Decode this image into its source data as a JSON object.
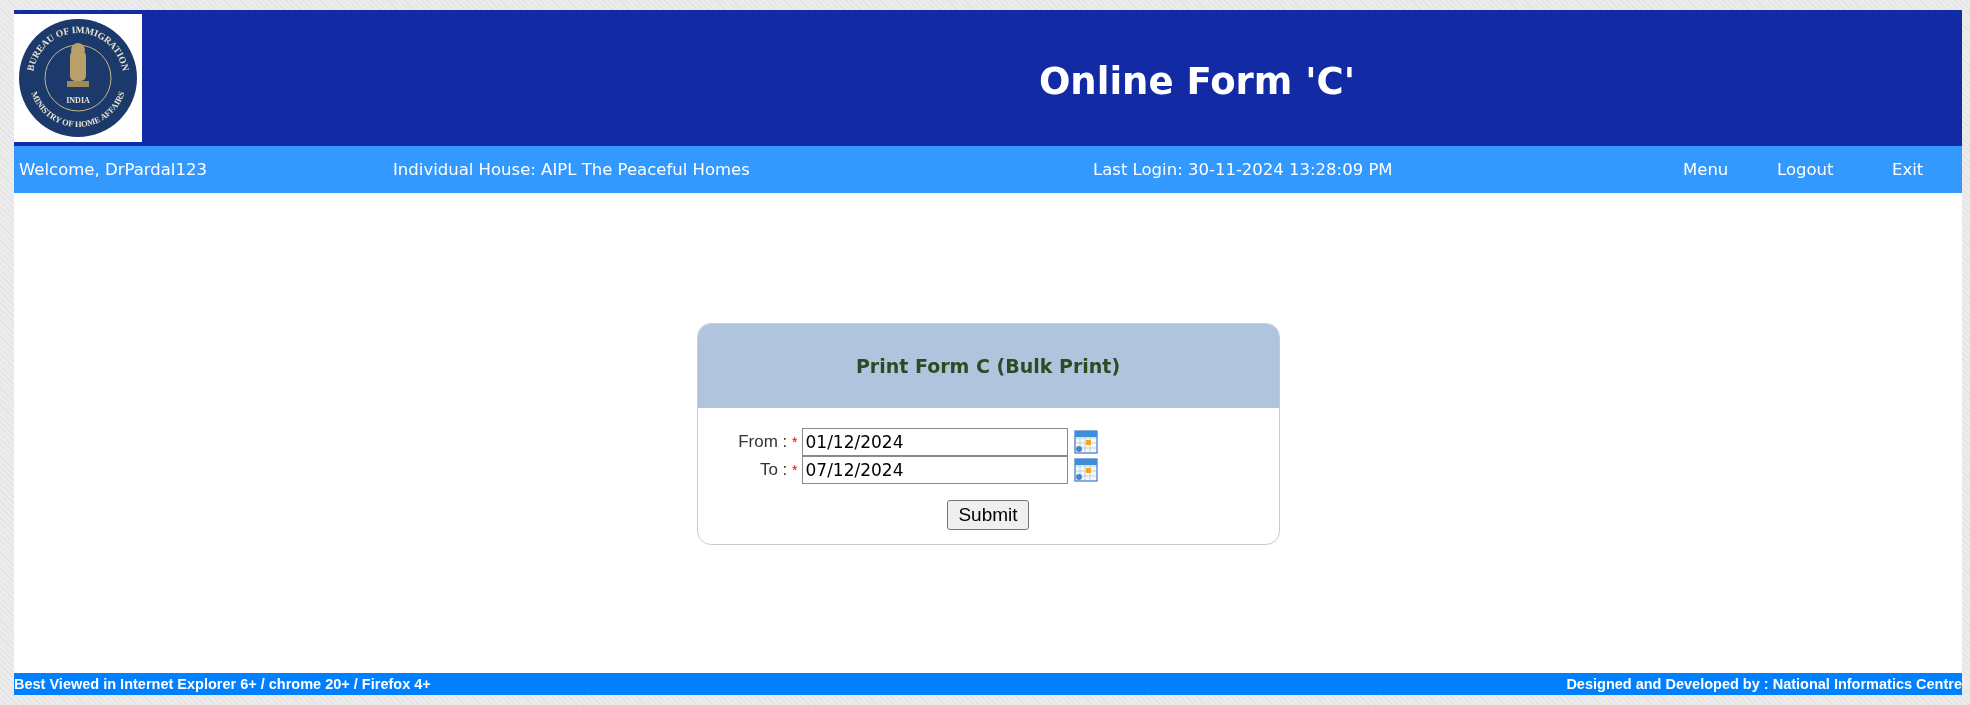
{
  "header": {
    "logo": {
      "top_text": "BUREAU OF IMMIGRATION",
      "bottom_text": "MINISTRY OF HOME AFFAIRS",
      "center_text": "INDIA"
    },
    "title": "Online Form 'C'"
  },
  "nav": {
    "welcome": "Welcome, DrPardal123",
    "house": "Individual House: AIPL The Peaceful Homes",
    "last_login": "Last Login: 30-11-2024 13:28:09 PM",
    "links": [
      "Menu",
      "Logout",
      "Exit"
    ]
  },
  "form": {
    "title": "Print Form C (Bulk Print)",
    "fields": [
      {
        "label": "From :",
        "required_mark": "*",
        "value": "01/12/2024"
      },
      {
        "label": "To :",
        "required_mark": "*",
        "value": "07/12/2024"
      }
    ],
    "submit": "Submit"
  },
  "footer": {
    "left": "Best Viewed in Internet Explorer 6+ / chrome 20+ / Firefox 4+",
    "right": "Designed and Developed by : National Informatics Centre"
  }
}
